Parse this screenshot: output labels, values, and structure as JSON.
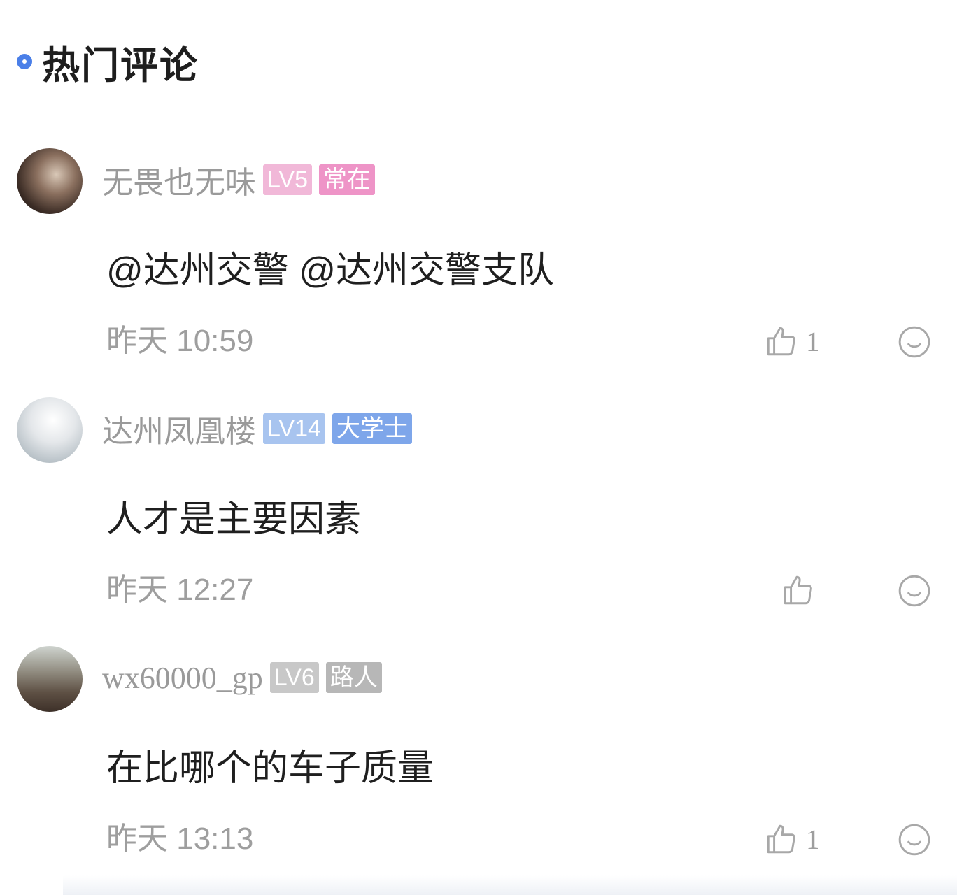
{
  "section": {
    "title": "热门评论"
  },
  "comments": [
    {
      "username": "无畏也无味",
      "level": "LV5",
      "title_badge": "常在",
      "level_color": "#f1b8d8",
      "title_color": "#ee94c7",
      "content": "@达州交警 @达州交警支队",
      "time": "昨天 10:59",
      "likes": "1"
    },
    {
      "username": "达州凤凰楼",
      "level": "LV14",
      "title_badge": "大学士",
      "level_color": "#a8c4ef",
      "title_color": "#7ea6ea",
      "content": "人才是主要因素",
      "time": "昨天 12:27",
      "likes": ""
    },
    {
      "username": "wx60000_gp",
      "level": "LV6",
      "title_badge": "路人",
      "level_color": "#c8c8c8",
      "title_color": "#b7b7b7",
      "content": "在比哪个的车子质量",
      "time": "昨天 13:13",
      "likes": "1"
    }
  ],
  "icons": {
    "like": "thumbs-up-icon",
    "reply": "comment-bubble-icon"
  },
  "colors": {
    "accent": "#4a7fe8",
    "muted_text": "#9e9e9e"
  }
}
